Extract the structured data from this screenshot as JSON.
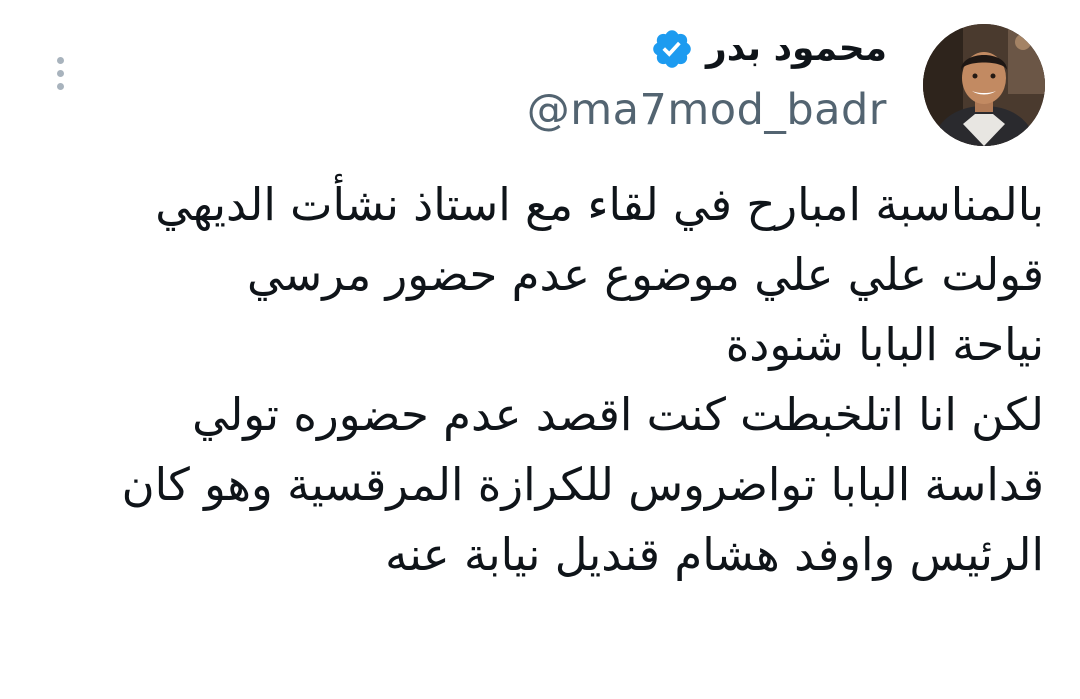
{
  "author": {
    "display_name": "محمود بدر",
    "handle": "@ma7mod_badr",
    "verified": true,
    "avatar_icon": "user-photo-avatar",
    "verified_color": "#1d9bf0"
  },
  "more_menu": {
    "icon": "vertical-ellipsis-icon"
  },
  "tweet": {
    "lines": [
      "بالمناسبة امبارح في لقاء مع استاذ نشأت الديهي",
      "قولت علي علي موضوع عدم حضور مرسي",
      "نياحة البابا شنودة",
      "لكن انا اتلخبطت كنت اقصد عدم حضوره تولي",
      "قداسة البابا تواضروس للكرازة المرقسية وهو كان",
      "الرئيس واوفد هشام قنديل نيابة عنه"
    ]
  },
  "colors": {
    "text": "#0f1419",
    "secondary_text": "#536471",
    "icon_gray": "#a8b3bd"
  }
}
